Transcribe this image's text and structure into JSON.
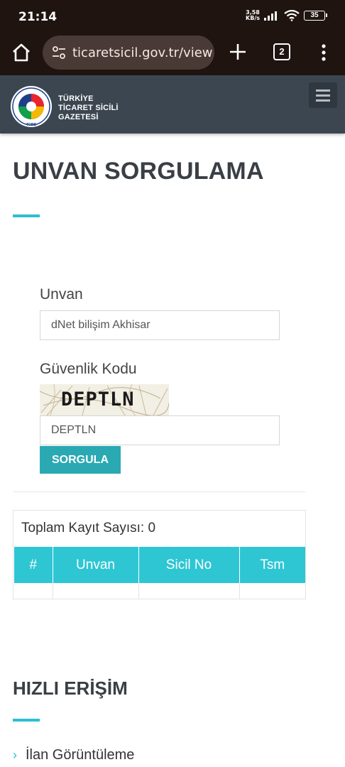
{
  "status_bar": {
    "time": "21:14",
    "net_speed_value": "3,58",
    "net_speed_unit": "KB/s",
    "battery": "35",
    "icons": [
      "signal-icon",
      "wifi-icon",
      "battery-icon"
    ]
  },
  "browser": {
    "url": "ticaretsicil.gov.tr/view",
    "tab_count": "2",
    "icons": [
      "home-icon",
      "site-settings-icon",
      "new-tab-icon",
      "tabs-icon",
      "more-icon"
    ]
  },
  "site": {
    "logo_line1": "TÜRKİYE",
    "logo_line2": "TİCARET SİCİLİ",
    "logo_line3": "GAZETESİ",
    "logo_ring_text": "TOBB",
    "header_color": "#3b4650",
    "accent_color": "#2bbfd1"
  },
  "page": {
    "title": "UNVAN SORGULAMA",
    "unvan_label": "Unvan",
    "unvan_value": "dNet bilişim Akhisar",
    "security_label": "Güvenlik Kodu",
    "captcha_text": "DEPTLN",
    "security_value": "DEPTLN",
    "submit_label": "SORGULA"
  },
  "results": {
    "count_label": "Toplam Kayıt Sayısı: 0",
    "columns": [
      "#",
      "Unvan",
      "Sicil No",
      "Tsm"
    ],
    "rows": []
  },
  "quick_access": {
    "title": "HIZLI ERİŞİM",
    "items": [
      {
        "label": "İlan Görüntüleme"
      }
    ]
  }
}
